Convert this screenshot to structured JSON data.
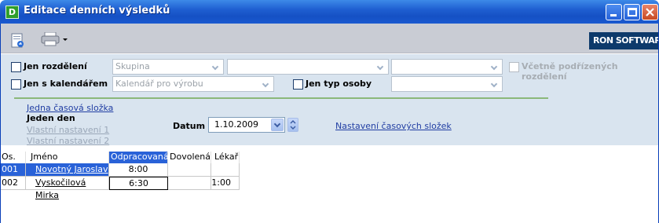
{
  "window": {
    "app_icon_letter": "D",
    "title": "Editace denních výsledků",
    "min_icon": "minimize-icon",
    "max_icon": "maximize-icon",
    "close_icon": "close-icon"
  },
  "toolbar": {
    "edit_icon": "document-edit-icon",
    "print_icon": "printer-icon",
    "logo_text": "RON SOFTWARE"
  },
  "filters": {
    "rozdeleni": {
      "label": "Jen rozdělení",
      "checked": false
    },
    "skupina": {
      "value": "Skupina"
    },
    "combo2": {
      "value": ""
    },
    "combo3": {
      "value": ""
    },
    "podrizenych": {
      "label": "Včetně podřízených rozdělení",
      "checked": false
    },
    "kalendar": {
      "label": "Jen s kalendářem",
      "checked": false
    },
    "kalendar_combo": {
      "value": "Kalendář pro výrobu"
    },
    "typ_osoby": {
      "label": "Jen typ osoby",
      "checked": false
    },
    "typ_osoby_combo": {
      "value": ""
    }
  },
  "views": {
    "item1": "Jedna časová složka",
    "item2": "Jeden den",
    "item3": "Vlastní nastavení 1",
    "item4": "Vlastní nastavení 2"
  },
  "date": {
    "label": "Datum",
    "value": "1.10.2009"
  },
  "settings_link": "Nastavení časových složek",
  "table": {
    "columns": [
      "Os. č.",
      "Jméno",
      "Odpracovaná",
      "Dovolená",
      "Lékař"
    ],
    "selected_column": 2,
    "rows": [
      {
        "num": "001",
        "name": "Novotný Jaroslav",
        "odpracovana": "8:00",
        "dovolena": "",
        "lekar": ""
      },
      {
        "num": "002",
        "name": "Vyskočilová Mirka",
        "odpracovana": "6:30",
        "dovolena": "",
        "lekar": "1:00"
      }
    ]
  },
  "colors": {
    "title_blue": "#1f5fd1",
    "selection_blue": "#2962d8",
    "panel_bg": "#d9e4ef",
    "separator_green": "#8bb87a"
  }
}
